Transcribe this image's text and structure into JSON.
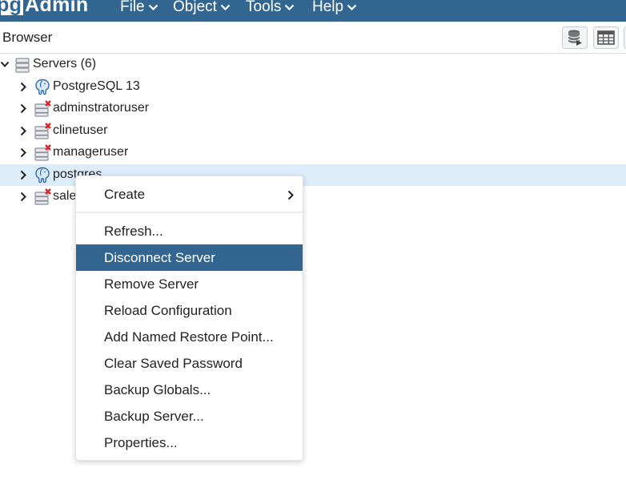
{
  "app": {
    "logo_pg": "pg",
    "logo_rest": "Admin"
  },
  "nav": {
    "file": "File",
    "object": "Object",
    "tools": "Tools",
    "help": "Help"
  },
  "panel": {
    "title": "Browser"
  },
  "tree": {
    "root": {
      "label": "Servers (6)",
      "expanded": true
    },
    "servers": [
      {
        "label": "PostgreSQL 13",
        "connected": true,
        "icon": "elephant-icon"
      },
      {
        "label": "adminstratoruser",
        "connected": false,
        "icon": "server-disconnected-icon"
      },
      {
        "label": "clinetuser",
        "connected": false,
        "icon": "server-disconnected-icon"
      },
      {
        "label": "manageruser",
        "connected": false,
        "icon": "server-disconnected-icon"
      },
      {
        "label": "postgres",
        "connected": true,
        "icon": "elephant-icon",
        "selected": true
      },
      {
        "label": "sale",
        "connected": false,
        "icon": "server-disconnected-icon"
      }
    ]
  },
  "context_menu": {
    "items": [
      {
        "label": "Create",
        "has_submenu": true
      },
      {
        "label": "Refresh..."
      },
      {
        "label": "Disconnect Server",
        "active": true
      },
      {
        "label": "Remove Server"
      },
      {
        "label": "Reload Configuration"
      },
      {
        "label": "Add Named Restore Point..."
      },
      {
        "label": "Clear Saved Password"
      },
      {
        "label": "Backup Globals..."
      },
      {
        "label": "Backup Server..."
      },
      {
        "label": "Properties..."
      }
    ]
  },
  "colors": {
    "navbar": "#326690",
    "selected_row": "#dcecf8",
    "menu_active": "#326690",
    "disconnected_x": "#d9262b"
  }
}
